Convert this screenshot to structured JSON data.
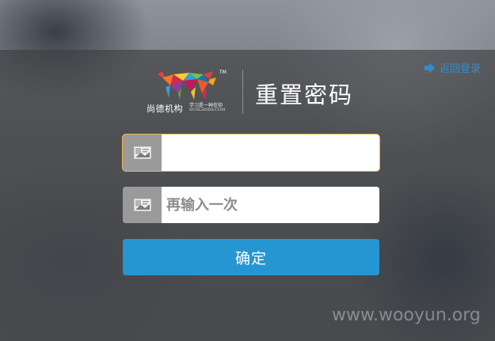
{
  "nav": {
    "back_label": "返回登录"
  },
  "logo": {
    "name": "尚德机构",
    "slogan": "学习是一种信仰",
    "domain": "SUNLANDS.COM",
    "tm": "TM"
  },
  "page": {
    "title": "重置密码"
  },
  "form": {
    "new_password": {
      "value": "",
      "placeholder": ""
    },
    "confirm_password": {
      "value": "",
      "placeholder": "再输入一次"
    },
    "submit_label": "确定"
  },
  "watermark": "www.wooyun.org",
  "colors": {
    "accent": "#2696d2",
    "link": "#2e8fd0",
    "focus_border": "#f0b44a",
    "icon_box": "#9a9a9a"
  },
  "icons": {
    "back": "arrow-right-icon",
    "field": "id-card-icon"
  }
}
